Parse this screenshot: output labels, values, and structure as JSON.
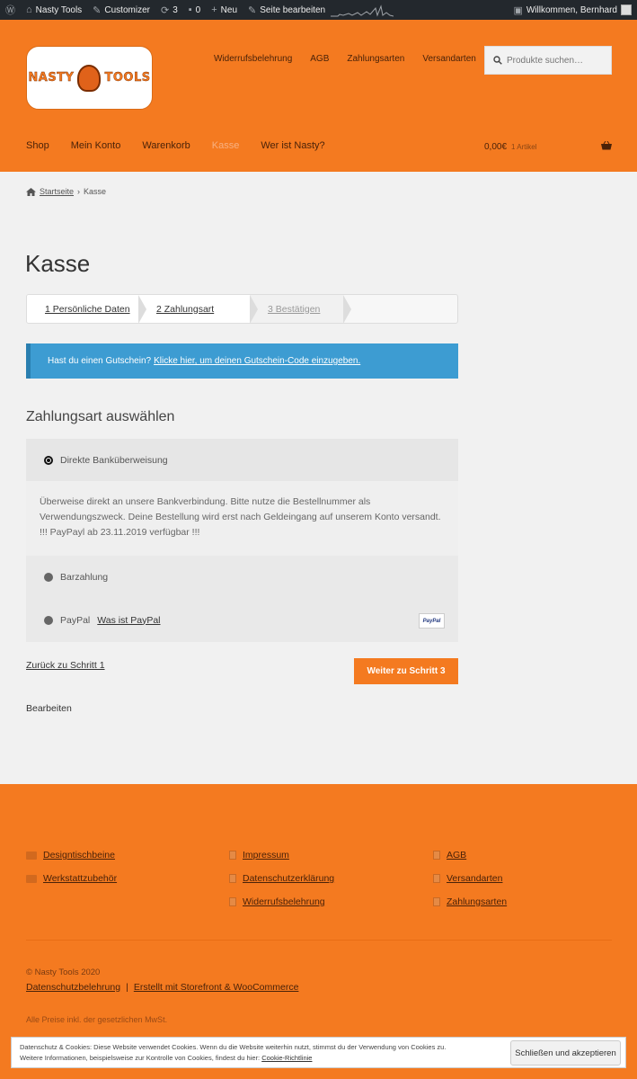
{
  "admin_bar": {
    "site": "Nasty Tools",
    "customizer": "Customizer",
    "updates": "3",
    "comments": "0",
    "new": "Neu",
    "edit_page": "Seite bearbeiten",
    "welcome": "Willkommen, Bernhard"
  },
  "header": {
    "logo_left": "NASTY",
    "logo_right": "TOOLS",
    "top_nav": [
      "Widerrufsbelehrung",
      "AGB",
      "Zahlungsarten",
      "Versandarten"
    ],
    "search_placeholder": "Produkte suchen…",
    "main_nav": [
      "Shop",
      "Mein Konto",
      "Warenkorb",
      "Kasse",
      "Wer ist Nasty?"
    ],
    "cart_total": "0,00€",
    "cart_items": "1 Artikel"
  },
  "breadcrumb": {
    "home": "Startseite",
    "separator": "›",
    "current": "Kasse"
  },
  "page_title": "Kasse",
  "steps": [
    "1 Persönliche Daten",
    "2 Zahlungsart",
    "3 Bestätigen"
  ],
  "coupon": {
    "text": "Hast du einen Gutschein?",
    "link": "Klicke hier, um deinen Gutschein-Code einzugeben."
  },
  "payment": {
    "heading": "Zahlungsart auswählen",
    "methods": [
      {
        "label": "Direkte Banküberweisung",
        "selected": true
      },
      {
        "label": "Barzahlung",
        "selected": false
      },
      {
        "label": "PayPal",
        "link": "Was ist PayPal",
        "selected": false
      }
    ],
    "description": [
      "Überweise direkt an unsere Bankverbindung. Bitte nutze die Bestellnummer als",
      "Verwendungszweck. Deine Bestellung wird erst nach Geldeingang auf unserem Konto versandt.",
      "!!! PayPayl ab 23.11.2019 verfügbar !!!"
    ],
    "paypal_badge": "PayPal"
  },
  "actions": {
    "back": "Zurück zu Schritt 1",
    "next": "Weiter zu Schritt 3",
    "edit": "Bearbeiten"
  },
  "footer": {
    "col1": [
      "Designtischbeine",
      "Werkstattzubehör"
    ],
    "col2": [
      "Impressum",
      "Datenschutzerklärung",
      "Widerrufsbelehrung"
    ],
    "col3": [
      "AGB",
      "Versandarten",
      "Zahlungsarten"
    ],
    "copyright": "© Nasty Tools 2020",
    "privacy_link": "Datenschutzbelehrung",
    "separator": "|",
    "built_with": "Erstellt mit Storefront & WooCommerce",
    "tax_note": "Alle Preise inkl. der gesetzlichen MwSt."
  },
  "cookie": {
    "line1": "Datenschutz & Cookies: Diese Website verwendet Cookies. Wenn du die Website weiterhin nutzt, stimmst du der Verwendung von Cookies zu.",
    "line2": "Weitere Informationen, beispielsweise zur Kontrolle von Cookies, findest du hier:",
    "policy_link": "Cookie-Richtlinie",
    "button": "Schließen und akzeptieren"
  },
  "colors": {
    "brand": "#f47a20",
    "info": "#3d9cd2",
    "admin_bar": "#23282d"
  }
}
